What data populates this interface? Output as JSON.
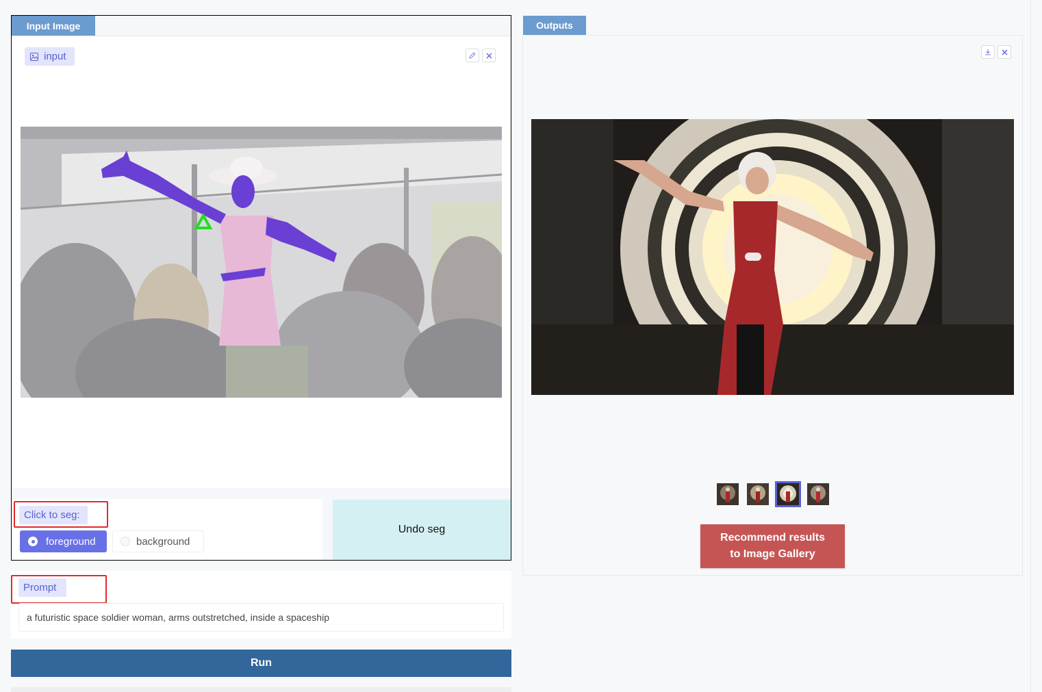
{
  "input_section": {
    "tab_label": "Input Image",
    "badge_label": "input",
    "icons": [
      "image-icon",
      "pencil-icon",
      "close-icon"
    ]
  },
  "segmentation": {
    "label": "Click to seg:",
    "options": [
      "foreground",
      "background"
    ],
    "selected": "foreground",
    "undo_label": "Undo seg"
  },
  "prompt": {
    "label": "Prompt",
    "value": "a futuristic space soldier woman, arms outstretched, inside a spaceship"
  },
  "run_label": "Run",
  "outputs": {
    "tab_label": "Outputs",
    "icons": [
      "download-icon",
      "close-icon"
    ],
    "thumbnail_count": 4,
    "selected_thumbnail": 3,
    "recommend_label_line1": "Recommend results",
    "recommend_label_line2": "to Image Gallery"
  },
  "colors": {
    "tab_blue": "#6b9bcf",
    "accent_purple": "#6970e6",
    "run_blue": "#33669a",
    "recommend_red": "#c55554",
    "highlight_red": "#e02a2a",
    "mask_purple": "#6a3fd4"
  }
}
